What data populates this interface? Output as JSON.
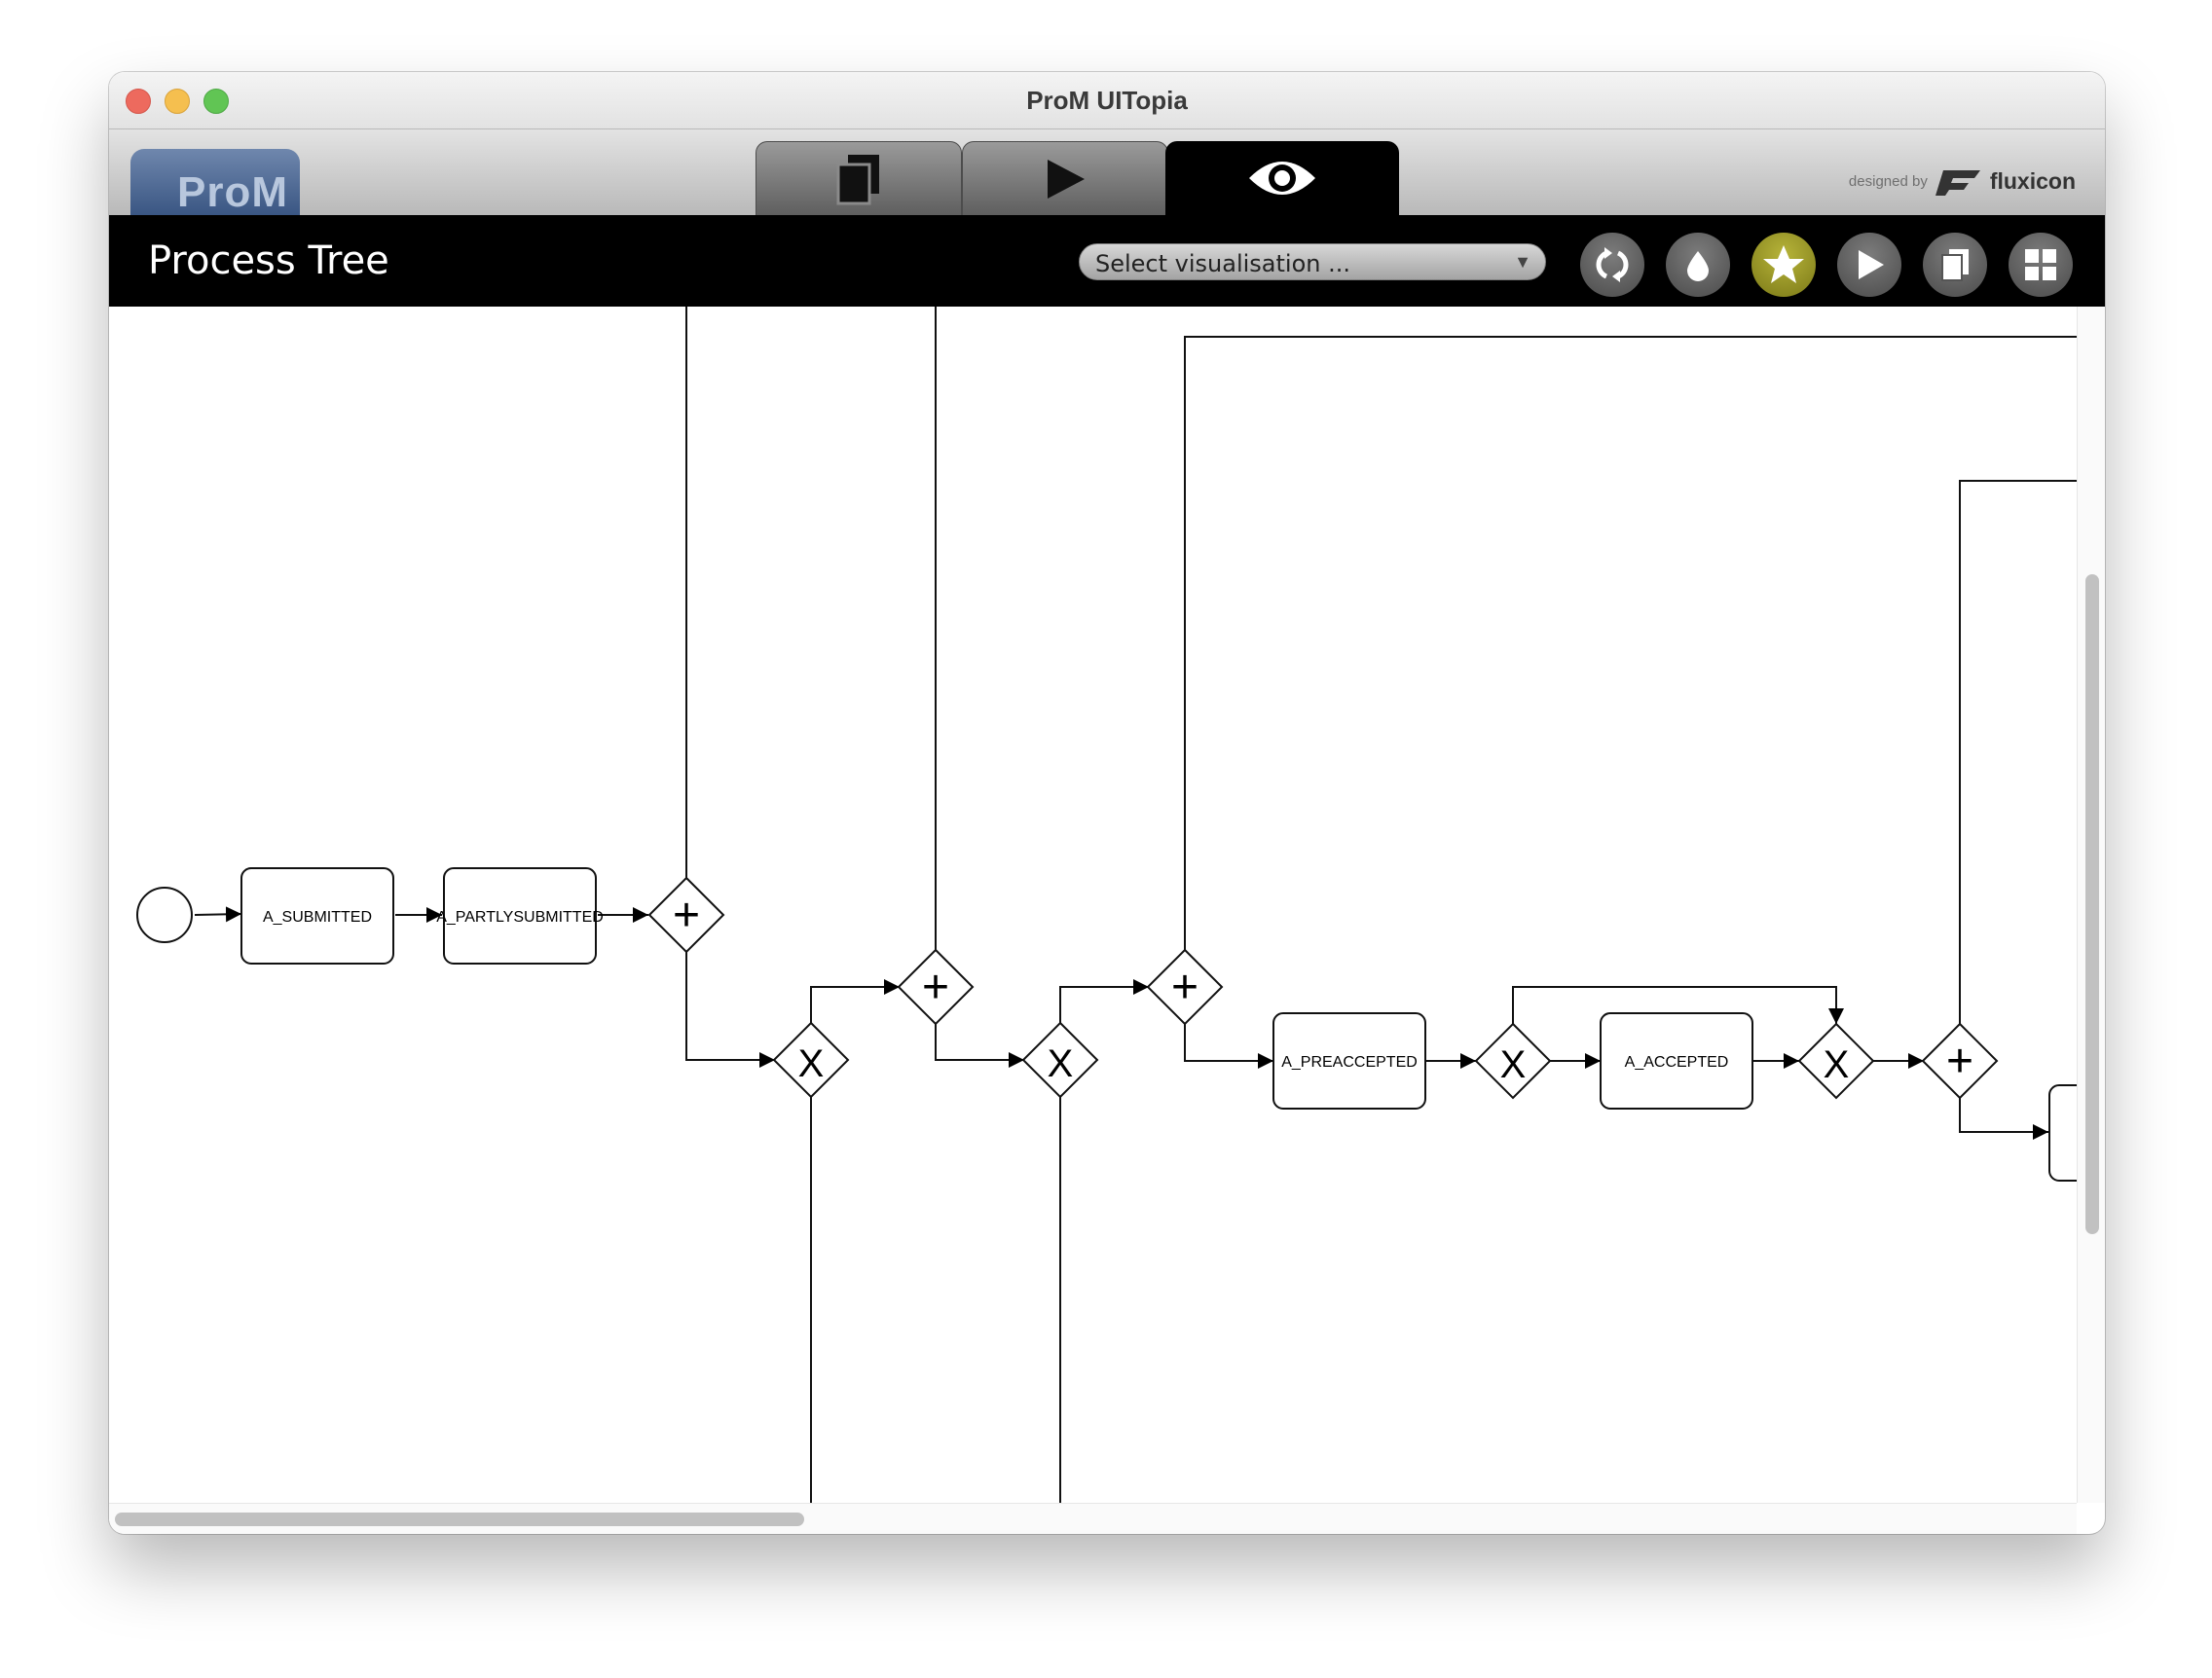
{
  "window": {
    "title": "ProM UITopia"
  },
  "logo": {
    "text": "ProM"
  },
  "tabs": [
    {
      "name": "workspace",
      "icon": "documents-icon"
    },
    {
      "name": "actions",
      "icon": "play-icon"
    },
    {
      "name": "views",
      "icon": "eye-icon",
      "active": true
    }
  ],
  "branding": {
    "designed_by": "designed by",
    "company": "fluxicon"
  },
  "header": {
    "title": "Process Tree",
    "select_placeholder": "Select visualisation ...",
    "buttons": [
      {
        "name": "refresh-button",
        "icon": "refresh-icon"
      },
      {
        "name": "drop-button",
        "icon": "drop-icon"
      },
      {
        "name": "favorite-button",
        "icon": "star-icon",
        "active": true
      },
      {
        "name": "play-button",
        "icon": "play-icon"
      },
      {
        "name": "copy-button",
        "icon": "copy-icon"
      },
      {
        "name": "grid-button",
        "icon": "grid-icon"
      }
    ]
  },
  "diagram": {
    "activities": [
      "A_SUBMITTED",
      "A_PARTLYSUBMITTED",
      "A_PREACCEPTED",
      "A_ACCEPTED"
    ],
    "gateway_and_symbol": "+",
    "gateway_xor_symbol": "X"
  },
  "colors": {
    "active_button": "#a3a02b",
    "header": "#000000"
  }
}
